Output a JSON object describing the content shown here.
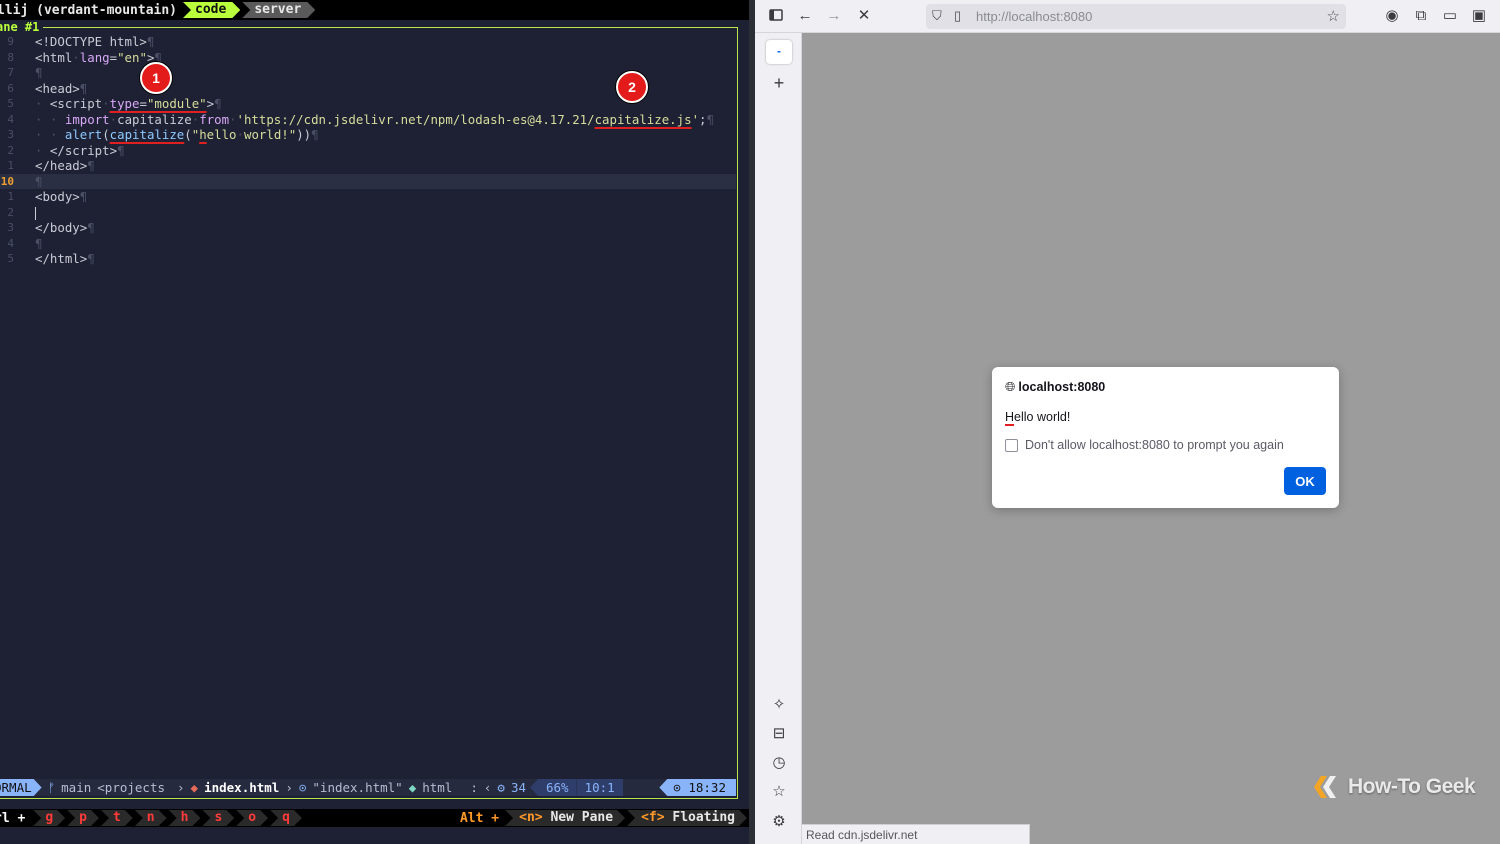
{
  "terminal": {
    "session_name": "llij (verdant-mountain)",
    "tabs": [
      {
        "label": "code",
        "active": true
      },
      {
        "label": "server",
        "active": false
      }
    ],
    "pane_title": "ane #1",
    "code_lines": [
      {
        "ln": "9",
        "html": "&lt;!DOCTYPE html&gt;<span class='pilcrow'>¶</span>"
      },
      {
        "ln": "8",
        "html": "&lt;html<span class='pilcrow'>·</span><span class='kw'>lang</span>=<span class='str'>\"en\"</span>&gt;<span class='pilcrow'>¶</span>"
      },
      {
        "ln": "7",
        "html": "<span class='pilcrow'>¶</span>"
      },
      {
        "ln": "6",
        "html": "&lt;head&gt;<span class='pilcrow'>¶</span>"
      },
      {
        "ln": "5",
        "html": "<span class='pilcrow'>·</span> &lt;script<span class='pilcrow'>·</span><span class='kw ul'>type</span><span class='ul'>=</span><span class='str ul'>\"module\"</span>&gt;<span class='pilcrow'>¶</span>"
      },
      {
        "ln": "4",
        "html": "<span class='pilcrow'>·</span> <span class='pilcrow'>·</span> <span class='kw'>import</span><span class='pilcrow'>·</span>capitalize<span class='pilcrow'>·</span><span class='kw'>from</span><span class='pilcrow'>·</span><span class='str'>'https://cdn.jsdelivr.net/npm/lodash-es@4.17.21/<span class='ul'>capitalize.js</span>'</span>;<span class='pilcrow'>¶</span>"
      },
      {
        "ln": "3",
        "html": "<span class='pilcrow'>·</span> <span class='pilcrow'>·</span> <span class='fn'>alert</span>(<span class='fn ul'>capitalize</span>(<span class='str'>\"<span class='ul'>h</span>ello<span class='pilcrow'>·</span>world!\"</span>))<span class='pilcrow'>¶</span>"
      },
      {
        "ln": "2",
        "html": "<span class='pilcrow'>·</span> &lt;/script&gt;<span class='pilcrow'>¶</span>"
      },
      {
        "ln": "1",
        "html": "&lt;/head&gt;<span class='pilcrow'>¶</span>"
      },
      {
        "ln": "10",
        "html": "<span class='pilcrow'>¶</span>",
        "current": true
      },
      {
        "ln": "1",
        "html": "&lt;body&gt;<span class='pilcrow'>¶</span>"
      },
      {
        "ln": "2",
        "html": "<span class='cursor-bar'></span>"
      },
      {
        "ln": "3",
        "html": "&lt;/body&gt;<span class='pilcrow'>¶</span>"
      },
      {
        "ln": "4",
        "html": "<span class='pilcrow'>¶</span>"
      },
      {
        "ln": "5",
        "html": "&lt;/html&gt;<span class='pilcrow'>¶</span>"
      }
    ],
    "markers": [
      "1",
      "2"
    ],
    "status": {
      "mode": "ORMAL",
      "branch": " main",
      "project": "<projects",
      "file": "index.html",
      "scope": "\"index.html\"",
      "lang": "html",
      "sep": ":",
      "count": "34",
      "percent": "66%",
      "position": "10:1",
      "time": "18:32"
    },
    "bottom_bar": {
      "ctrl": "rl +",
      "keys": [
        "g",
        "p",
        "t",
        "n",
        "h",
        "s",
        "o",
        "q"
      ],
      "alt": "Alt +",
      "hint_new_key": "<n>",
      "hint_new_label": "New Pane",
      "hint_float_key": "<f>",
      "hint_float_label": "Floating"
    }
  },
  "browser": {
    "url": "http://localhost:8080",
    "tab_thumb": "-",
    "status_link": "Read cdn.jsdelivr.net",
    "dialog": {
      "origin": "localhost:8080",
      "message_first": "H",
      "message_rest": "ello world!",
      "checkbox_label": "Don't allow localhost:8080 to prompt you again",
      "ok_label": "OK"
    },
    "icons": {
      "sidebar_toggle": "sidebar-icon",
      "back": "back-arrow-icon",
      "forward": "forward-arrow-icon",
      "stop": "close-icon"
    }
  },
  "watermark": {
    "text": "How-To Geek"
  },
  "colors": {
    "accent_green": "#b9ff3b",
    "firefox_blue": "#0061e0",
    "marker_red": "#e41b1b"
  }
}
